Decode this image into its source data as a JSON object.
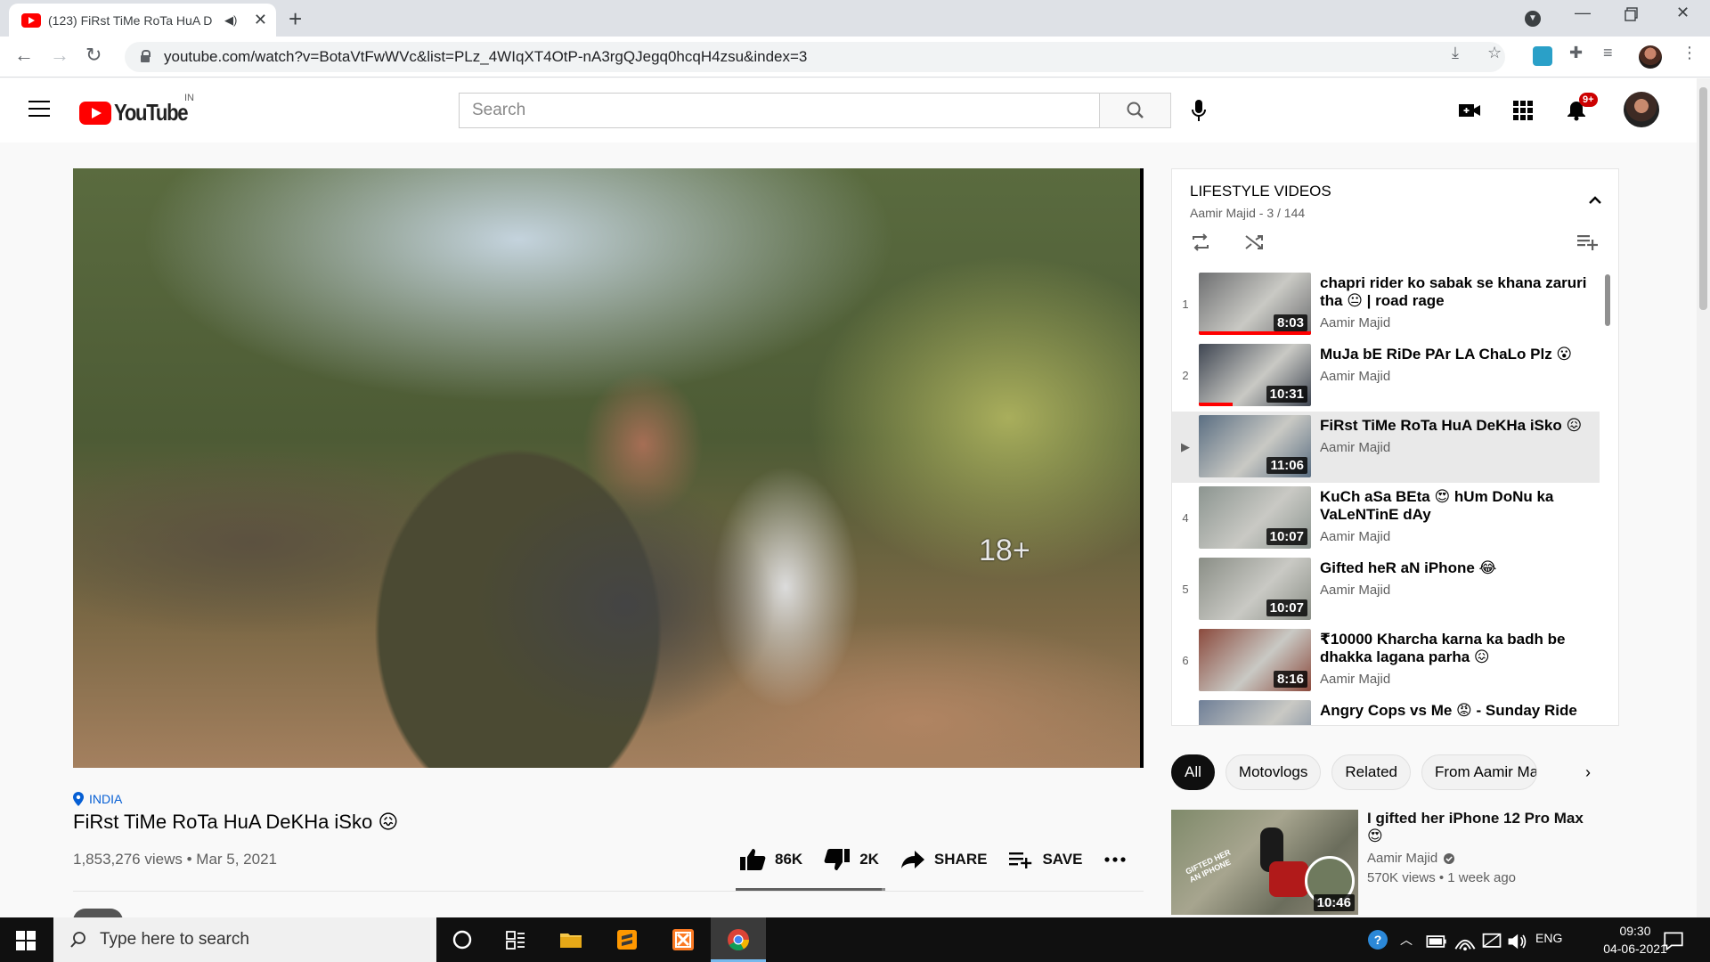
{
  "browser": {
    "tab_title": "(123) FiRst TiMe RoTa HuA D",
    "url": "youtube.com/watch?v=BotaVtFwWVc&list=PLz_4WIqXT4OtP-nA3rgQJegq0hcqH4zsu&index=3"
  },
  "header": {
    "logo_text": "YouTube",
    "country_code": "IN",
    "search_placeholder": "Search",
    "notification_count": "9+"
  },
  "video": {
    "content_rating": "18+",
    "location": "INDIA",
    "title": "FiRst TiMe RoTa HuA DeKHa iSko 😖",
    "views": "1,853,276 views",
    "date": "Mar 5, 2021",
    "likes": "86K",
    "dislikes": "2K",
    "share_label": "SHARE",
    "save_label": "SAVE",
    "like_ratio": 0.977
  },
  "playlist": {
    "title": "LIFESTYLE VIDEOS",
    "subtitle": "Aamir Majid - 3 / 144",
    "items": [
      {
        "index": "1",
        "title": "chapri rider ko sabak se khana zaruri tha 😐 | road rage",
        "channel": "Aamir Majid",
        "duration": "8:03",
        "progress": 1.0,
        "active": false,
        "thumb": "#6e6f71"
      },
      {
        "index": "2",
        "title": "MuJa bE RiDe PAr LA ChaLo Plz 😮",
        "channel": "Aamir Majid",
        "duration": "10:31",
        "progress": 0.3,
        "active": false,
        "thumb": "#3f4652"
      },
      {
        "index": "▶",
        "title": "FiRst TiMe RoTa HuA DeKHa iSko 😖",
        "channel": "Aamir Majid",
        "duration": "11:06",
        "progress": 0,
        "active": true,
        "thumb": "#5a6e82"
      },
      {
        "index": "4",
        "title": "KuCh aSa BEta 😍 hUm DoNu ka VaLeNTinE dAy",
        "channel": "Aamir Majid",
        "duration": "10:07",
        "progress": 0,
        "active": false,
        "thumb": "#8c9590"
      },
      {
        "index": "5",
        "title": "Gifted heR aN iPhone 😂",
        "channel": "Aamir Majid",
        "duration": "10:07",
        "progress": 0,
        "active": false,
        "thumb": "#8a8e86"
      },
      {
        "index": "6",
        "title": "₹10000 Kharcha karna ka badh be dhakka lagana parha 😖",
        "channel": "Aamir Majid",
        "duration": "8:16",
        "progress": 0,
        "active": false,
        "thumb": "#8b4a3d"
      },
      {
        "index": "",
        "title": "Angry Cops vs Me 😡 - Sunday Ride",
        "channel": "Aamir Majid",
        "duration": "",
        "progress": 0,
        "active": false,
        "thumb": "#6f7f97"
      }
    ]
  },
  "chips": [
    {
      "label": "All",
      "active": true
    },
    {
      "label": "Motovlogs",
      "active": false
    },
    {
      "label": "Related",
      "active": false
    },
    {
      "label": "From Aamir Majid",
      "active": false
    }
  ],
  "recommendation": {
    "title": "I gifted her iPhone 12 Pro Max 😍",
    "channel": "Aamir Majid",
    "meta": "570K views • 1 week ago",
    "duration": "10:46",
    "thumb_caption": "GIFTED HER AN IPHONE"
  },
  "taskbar": {
    "search_placeholder": "Type here to search",
    "language": "ENG",
    "time": "09:30",
    "date": "04-06-2021"
  },
  "colors": {
    "brand_red": "#ff0000",
    "link_blue": "#065fd4",
    "taskbar_bg": "#101010"
  }
}
